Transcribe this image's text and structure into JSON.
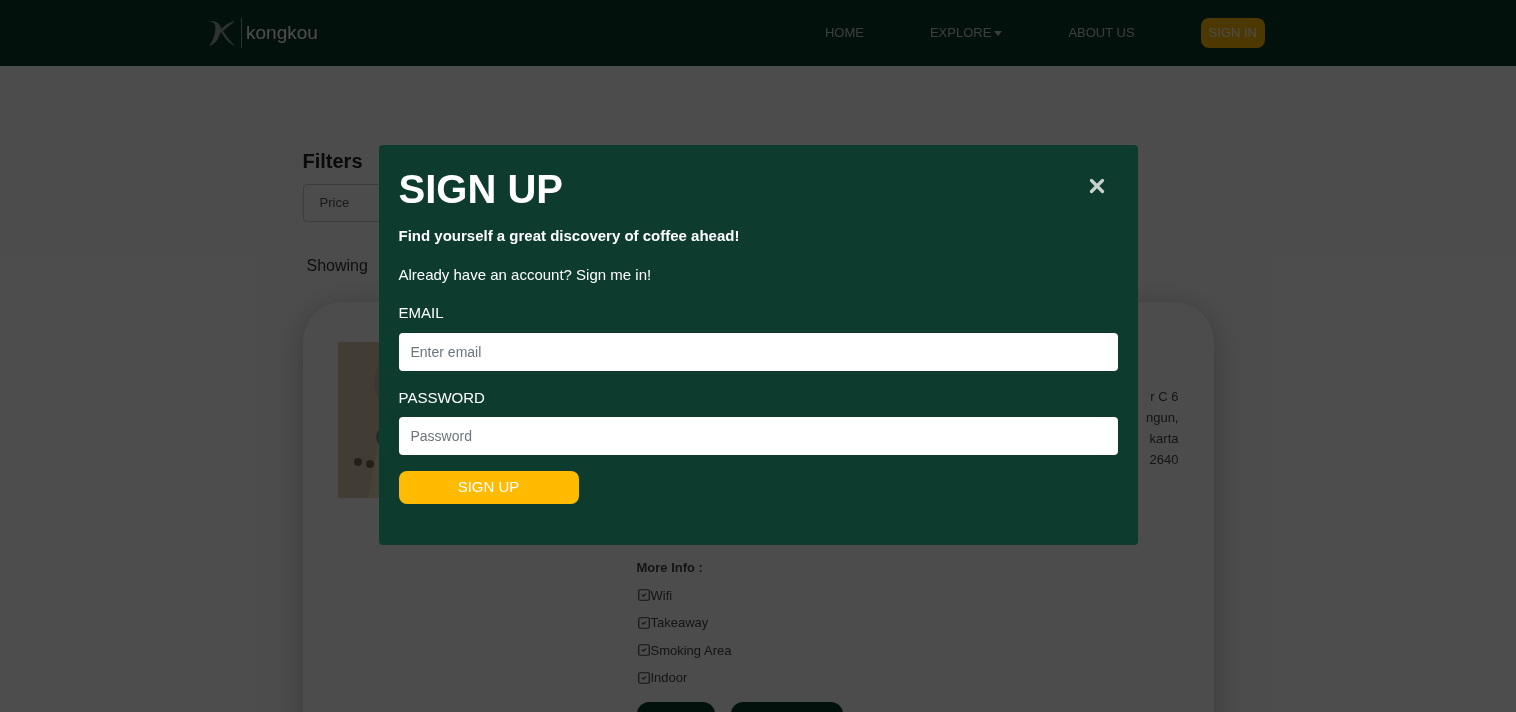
{
  "nav": {
    "brand": "kongkou",
    "links": [
      {
        "label": "HOME",
        "dropdown": false
      },
      {
        "label": "EXPLORE",
        "dropdown": true
      },
      {
        "label": "ABOUT US",
        "dropdown": false
      }
    ],
    "sign_in": "SIGN IN"
  },
  "filters": {
    "title": "Filters",
    "select": {
      "placeholder": "Price"
    }
  },
  "results": {
    "showing": "Showing"
  },
  "card": {
    "address_lines": [
      "r C 6",
      "ngun,",
      "karta",
      "2640"
    ],
    "more_info": {
      "title": "More Info :",
      "items": [
        {
          "label": "Wifi",
          "checked": true
        },
        {
          "label": "Takeaway",
          "checked": true
        },
        {
          "label": "Smoking Area",
          "checked": true
        },
        {
          "label": "Indoor",
          "checked": true
        }
      ]
    }
  },
  "modal": {
    "title": "SIGN UP",
    "subtitle": "Find yourself a great discovery of coffee ahead!",
    "signin_prompt": "Already have an account? Sign me in!",
    "fields": [
      {
        "label": "EMAIL",
        "placeholder": "Enter email"
      },
      {
        "label": "PASSWORD",
        "placeholder": "Password"
      }
    ],
    "submit": "SIGN UP"
  }
}
